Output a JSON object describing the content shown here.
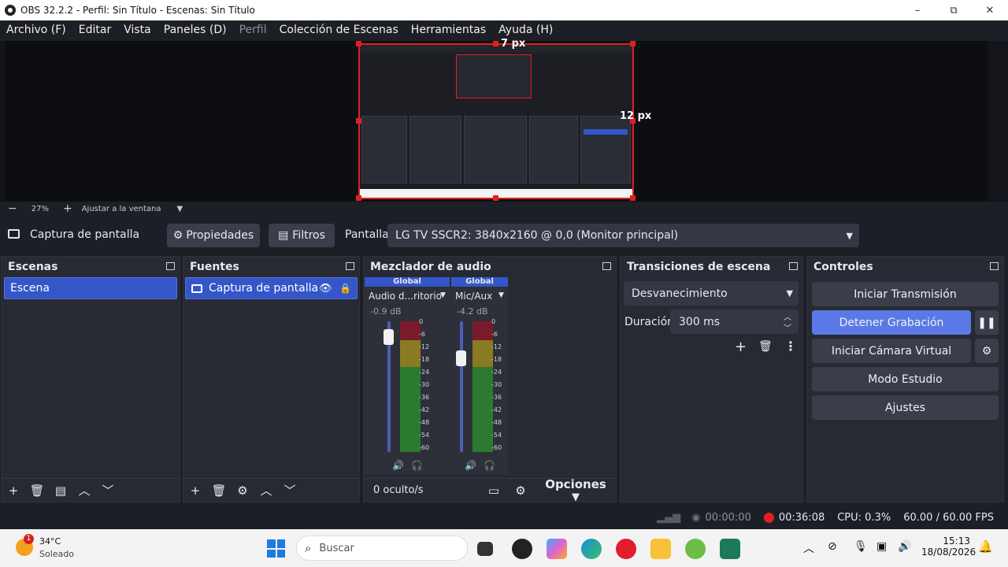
{
  "window": {
    "title": "OBS 32.2.2 - Perfil: Sin Título - Escenas: Sin Título",
    "min": "–",
    "restore": "⧉",
    "close": "✕"
  },
  "menu": [
    "Archivo (F)",
    "Editar",
    "Vista",
    "Paneles (D)",
    "Perfil",
    "Colección de Escenas",
    "Herramientas",
    "Ayuda (H)"
  ],
  "preview": {
    "width_label": "7 px",
    "height_label": "12 px"
  },
  "zoom": {
    "minus": "−",
    "level": "27%",
    "plus": "+",
    "fit": "Ajustar a la ventana",
    "menu": "▼"
  },
  "source_bar": {
    "source_name": "Captura de pantalla",
    "properties": "Propiedades",
    "filters": "Filtros",
    "display_label": "Pantalla",
    "display_value": "LG TV SSCR2: 3840x2160 @ 0,0 (Monitor principal)"
  },
  "scenes": {
    "title": "Escenas",
    "items": [
      "Escena"
    ]
  },
  "sources": {
    "title": "Fuentes",
    "items": [
      "Captura de pantalla"
    ]
  },
  "mixer": {
    "title": "Mezclador de audio",
    "channels": [
      {
        "group": "Global",
        "name": "Audio d...ritorio",
        "db": "-0.9 dB",
        "volume": 0.94
      },
      {
        "group": "Global",
        "name": "Mic/Aux",
        "db": "-4.2 dB",
        "volume": 0.78
      }
    ],
    "scale": [
      "0",
      "-6",
      "-12",
      "-18",
      "-24",
      "-30",
      "-36",
      "-42",
      "-48",
      "-54",
      "-60"
    ],
    "hidden": "0 oculto/s",
    "options": "Opciones"
  },
  "transitions": {
    "title": "Transiciones de escena",
    "selected": "Desvanecimiento",
    "duration_label": "Duración",
    "duration_value": "300 ms"
  },
  "controls": {
    "title": "Controles",
    "buttons": [
      "Iniciar Transmisión",
      "Detener Grabación",
      "Iniciar Cámara Virtual",
      "Modo Estudio",
      "Ajustes"
    ]
  },
  "status": {
    "stream_time": "00:00:00",
    "rec_time": "00:36:08",
    "cpu": "CPU: 0.3%",
    "fps": "60.00 / 60.00 FPS"
  },
  "taskbar": {
    "weather_temp": "34°C",
    "weather_desc": "Soleado",
    "weather_badge": "1",
    "search": "Buscar",
    "time": "15:13",
    "date": "18/08/2026"
  },
  "colors": {
    "accent": "#3556c9",
    "record": "#e02020",
    "panel": "#272a33",
    "bg": "#1d1f26"
  }
}
